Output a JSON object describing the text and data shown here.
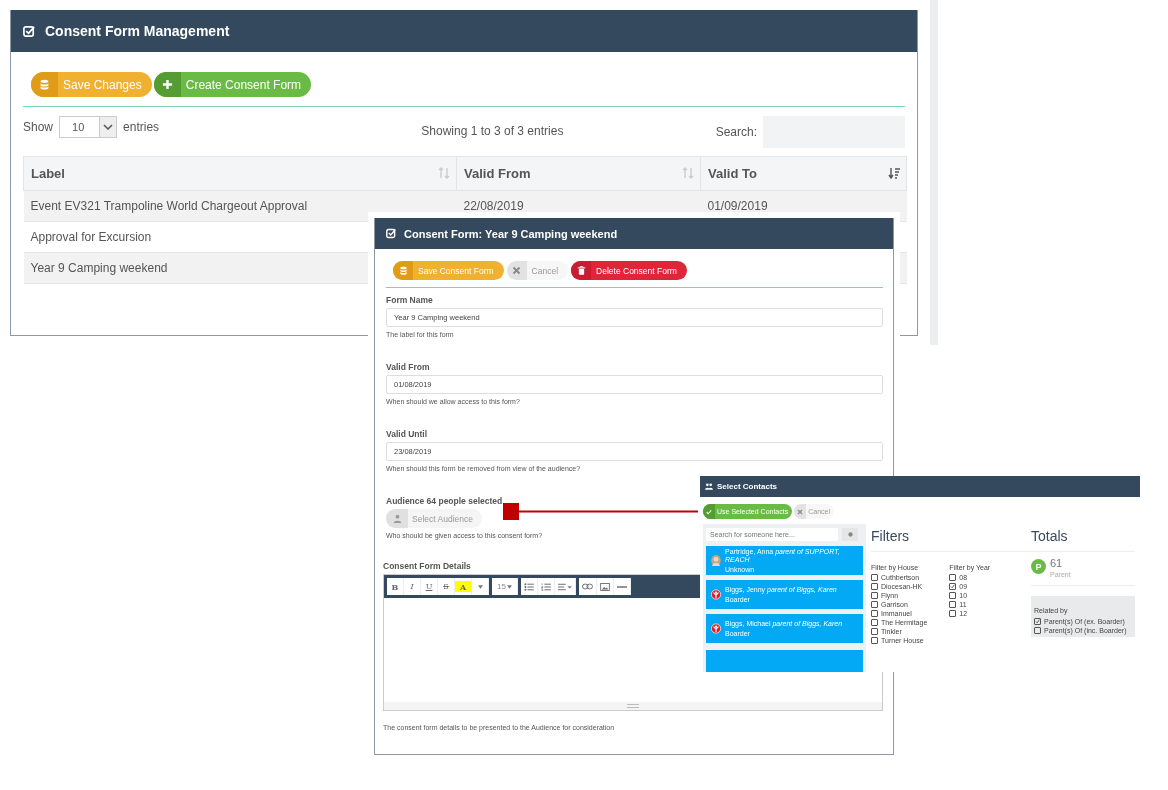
{
  "main_panel": {
    "title": "Consent Form Management",
    "buttons": [
      {
        "label": "Save Changes",
        "kind": "save"
      },
      {
        "label": "Create Consent Form",
        "kind": "create"
      }
    ],
    "length": {
      "prefix": "Show",
      "value": "10",
      "suffix": "entries"
    },
    "info": "Showing 1 to 3 of 3 entries",
    "search": {
      "label": "Search:"
    },
    "table": {
      "columns": [
        {
          "label": "Label",
          "sorted": false
        },
        {
          "label": "Valid From",
          "sorted": false
        },
        {
          "label": "Valid To",
          "sorted": true
        }
      ],
      "rows": [
        [
          "Event EV321 Trampoline World Chargeout Approval",
          "22/08/2019",
          "01/09/2019"
        ],
        [
          "Approval for Excursion"
        ],
        [
          "Year 9 Camping weekend"
        ]
      ]
    }
  },
  "form_panel": {
    "title": "Consent Form: Year 9 Camping weekend",
    "buttons": [
      {
        "label": "Save Consent Form",
        "kind": "save"
      },
      {
        "label": "Cancel",
        "kind": "cancel"
      },
      {
        "label": "Delete Consent Form",
        "kind": "delete"
      }
    ],
    "fields": [
      {
        "label": "Form Name",
        "value": "Year 9 Camping weekend",
        "help": "The label for this form"
      },
      {
        "label": "Valid From",
        "value": "01/08/2019",
        "help": "When should we allow access to this form?"
      },
      {
        "label": "Valid Until",
        "value": "23/08/2019",
        "help": "When should this form be removed from view of the audience?"
      }
    ],
    "audience": {
      "label": "Audience 64 people selected",
      "button": "Select Audience",
      "help": "Who should be given access to this consent form?"
    },
    "details": {
      "label": "Consent Form Details",
      "toolbar": [
        [
          {
            "kind": "bold",
            "label": "B"
          },
          {
            "kind": "italic",
            "label": "I"
          },
          {
            "kind": "underline",
            "label": "U"
          },
          {
            "kind": "strike",
            "label": "S"
          },
          {
            "kind": "highlight",
            "label": "A"
          },
          {
            "kind": "dropdown"
          }
        ],
        [
          {
            "kind": "size",
            "label": "15"
          }
        ],
        [
          {
            "kind": "ul"
          },
          {
            "kind": "ol"
          },
          {
            "kind": "align"
          }
        ],
        [
          {
            "kind": "link"
          },
          {
            "kind": "image"
          },
          {
            "kind": "hr"
          }
        ]
      ],
      "help": "The consent form details to be presented to the Audience for consideration"
    }
  },
  "contacts_panel": {
    "title": "Select Contacts",
    "buttons": [
      {
        "label": "Use Selected Contacts",
        "kind": "use"
      },
      {
        "label": "Cancel",
        "kind": "cancel"
      }
    ],
    "search": {
      "placeholder": "Search for someone here..."
    },
    "contacts": [
      {
        "kind": "photo",
        "name": "Partridge, Anna *parent of SUPPORT, REACH*",
        "status": "Unknown"
      },
      {
        "kind": "logo",
        "name": "Biggs, Jenny *parent of Biggs, Karen*",
        "status": "Boarder"
      },
      {
        "kind": "logo",
        "name": "Biggs, Michael *parent of Biggs, Karen*",
        "status": "Boarder"
      }
    ],
    "filters": {
      "title": "Filters",
      "groups": [
        {
          "label": "Filter by House",
          "options": [
            {
              "label": "Cuthbertson",
              "checked": false
            },
            {
              "label": "Diocesan-HK",
              "checked": false
            },
            {
              "label": "Flynn",
              "checked": false
            },
            {
              "label": "Garrison",
              "checked": false
            },
            {
              "label": "Immanuel",
              "checked": false
            },
            {
              "label": "The Hermitage",
              "checked": false
            },
            {
              "label": "Tinkler",
              "checked": false
            },
            {
              "label": "Turner House",
              "checked": false
            }
          ]
        },
        {
          "label": "Filter by Year",
          "options": [
            {
              "label": "08",
              "checked": false
            },
            {
              "label": "09",
              "checked": true
            },
            {
              "label": "10",
              "checked": false
            },
            {
              "label": "11",
              "checked": false
            },
            {
              "label": "12",
              "checked": false
            }
          ]
        }
      ]
    },
    "totals": {
      "title": "Totals",
      "badge": "P",
      "count": "61",
      "caption": "Parent",
      "related": {
        "label": "Related by",
        "options": [
          {
            "label": "Parent(s) Of (ex. Boarder)",
            "checked": true
          },
          {
            "label": "Parent(s) Of (inc. Boarder)",
            "checked": false
          }
        ]
      }
    }
  }
}
